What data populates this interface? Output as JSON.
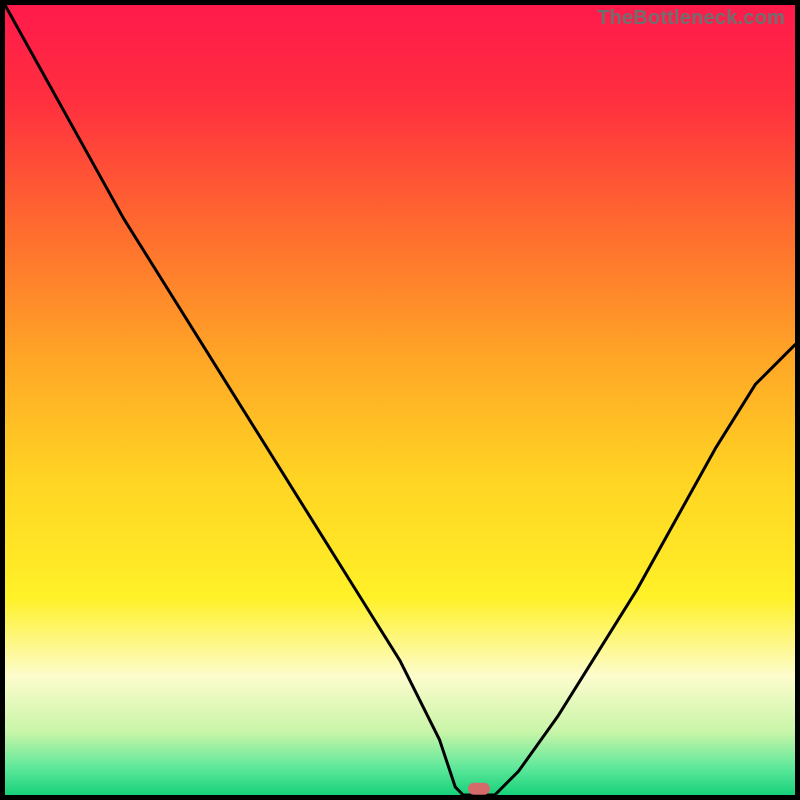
{
  "watermark": "TheBottleneck.com",
  "chart_data": {
    "type": "line",
    "title": "",
    "xlabel": "",
    "ylabel": "",
    "xlim": [
      0,
      100
    ],
    "ylim": [
      0,
      100
    ],
    "x": [
      0,
      5,
      10,
      15,
      20,
      25,
      30,
      35,
      40,
      45,
      50,
      55,
      57,
      58,
      62,
      65,
      70,
      75,
      80,
      85,
      90,
      95,
      100
    ],
    "values": [
      100,
      91,
      82,
      73,
      65,
      57,
      49,
      41,
      33,
      25,
      17,
      7,
      1,
      0,
      0,
      3,
      10,
      18,
      26,
      35,
      44,
      52,
      57
    ],
    "optimum_x": 60,
    "gradient_stops": [
      {
        "offset": 0.0,
        "color": "#ff1a4b"
      },
      {
        "offset": 0.12,
        "color": "#ff2f3f"
      },
      {
        "offset": 0.28,
        "color": "#ff6a2f"
      },
      {
        "offset": 0.45,
        "color": "#ffa726"
      },
      {
        "offset": 0.6,
        "color": "#ffd423"
      },
      {
        "offset": 0.75,
        "color": "#fff128"
      },
      {
        "offset": 0.85,
        "color": "#fdfccd"
      },
      {
        "offset": 0.92,
        "color": "#c9f5a8"
      },
      {
        "offset": 0.965,
        "color": "#5fe89b"
      },
      {
        "offset": 1.0,
        "color": "#17d17a"
      }
    ],
    "marker": {
      "x": 60,
      "y": 0.8,
      "color": "#d46a6a"
    }
  }
}
